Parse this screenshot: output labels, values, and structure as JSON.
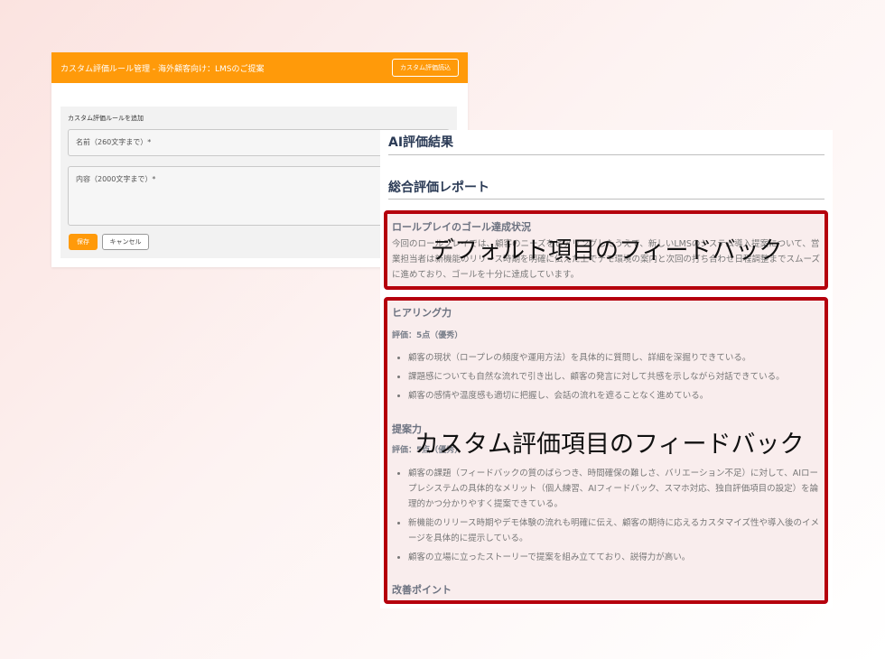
{
  "left_card": {
    "header_title": "カスタム評価ルール管理 - 海外顧客向け：LMSのご提案",
    "header_button": "カスタム評価読込",
    "form_title": "カスタム評価ルールを追加",
    "name_placeholder": "名前（260文字まで）*",
    "content_placeholder": "内容（2000文字まで）*",
    "save_label": "保存",
    "cancel_label": "キャンセル"
  },
  "right_panel": {
    "ai_result_heading": "AI評価結果",
    "report_heading": "総合評価レポート",
    "goal_section": {
      "title": "ロールプレイのゴール達成状況",
      "text": "今回のロールプレイでは、顧客のニーズをヒアリングしたうえで、新しいLMSのシステム導入提案について、営業担当者は新機能のリリース時期を明確に伝えた上でデモ環境の案内と次回の打ち合わせ日程調整までスムーズに進めており、ゴールを十分に達成しています。"
    },
    "hearing_section": {
      "title": "ヒアリング力",
      "rating": "評価：5点（優秀）",
      "bullets": [
        "顧客の現状（ロープレの頻度や運用方法）を具体的に質問し、詳細を深掘りできている。",
        "課題感についても自然な流れで引き出し、顧客の発言に対して共感を示しながら対話できている。",
        "顧客の感情や温度感も適切に把握し、会話の流れを遮ることなく進めている。"
      ]
    },
    "proposal_section": {
      "title": "提案力",
      "rating": "評価：5点（優秀）",
      "bullets": [
        "顧客の課題（フィードバックの質のばらつき、時間確保の難しさ、バリエーション不足）に対して、AIロープレシステムの具体的なメリット（個人練習、AIフィードバック、スマホ対応、独自評価項目の設定）を論理的かつ分かりやすく提案できている。",
        "新機能のリリース時期やデモ体験の流れも明確に伝え、顧客の期待に応えるカスタマイズ性や導入後のイメージを具体的に提示している。",
        "顧客の立場に立ったストーリーで提案を組み立てており、説得力が高い。"
      ]
    },
    "improvement_title": "改善ポイント"
  },
  "overlays": {
    "default_feedback": "デフォルト項目のフィードバック",
    "custom_feedback": "カスタム評価項目のフィードバック"
  },
  "colors": {
    "accent_orange": "#ff9a0a",
    "highlight_red": "#b5000d",
    "heading_navy": "#2a3a55"
  }
}
